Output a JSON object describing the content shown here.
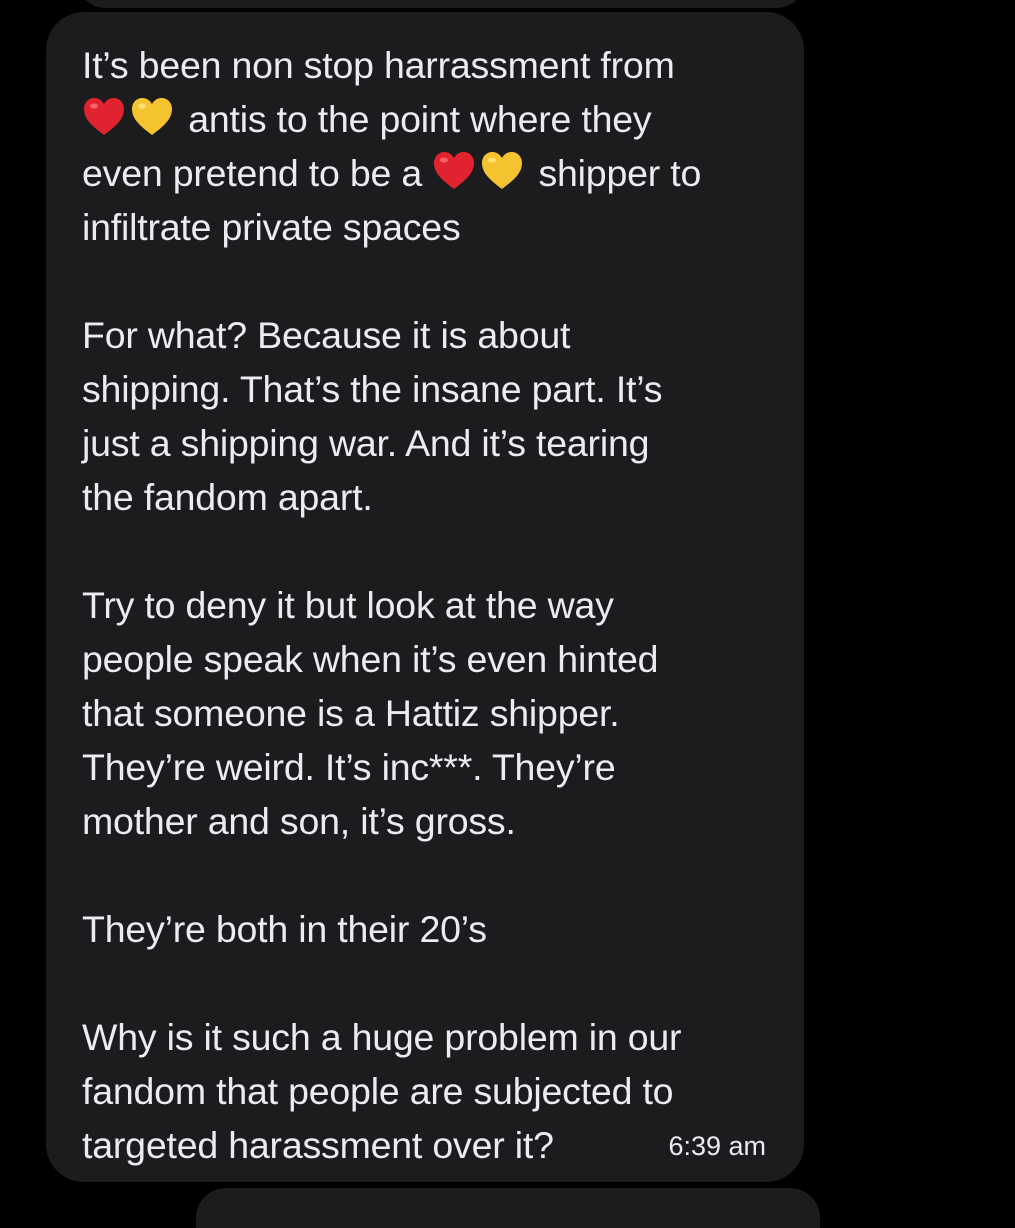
{
  "message": {
    "p1_a": "It’s been non stop harrassment from",
    "p1_b": "antis to the point where they",
    "p1_c1": "even pretend to be a",
    "p1_c2": "shipper to",
    "p1_d": "infiltrate private spaces",
    "p2_a": "For what? Because it is about",
    "p2_b": "shipping. That’s the insane part. It’s",
    "p2_c": "just a shipping war. And it’s tearing",
    "p2_d": "the fandom apart.",
    "p3_a": "Try to deny it but look at the way",
    "p3_b": "people speak when it’s even hinted",
    "p3_c": "that someone is a Hattiz shipper.",
    "p3_d": "They’re weird. It’s inc***. They’re",
    "p3_e": "mother and son, it’s gross.",
    "p4_a": "They’re both in their 20’s",
    "p5_a": "Why is it such a huge problem in our",
    "p5_b": "fandom that people are subjected to",
    "p5_c": "targeted harassment over it?",
    "timestamp": "6:39 am",
    "emojis": [
      "red-heart",
      "yellow-heart"
    ]
  },
  "colors": {
    "background": "#000000",
    "bubble": "#1c1c1e",
    "text": "#ebebf0",
    "red_heart": "#e0232e",
    "yellow_heart": "#f5c230"
  }
}
